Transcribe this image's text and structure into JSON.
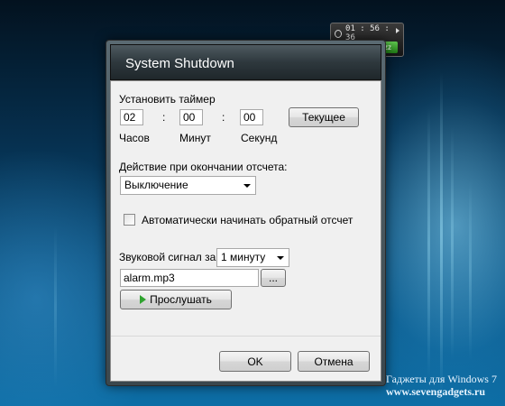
{
  "gadget": {
    "time": "01 : 56 : 36",
    "icons": [
      "clock-icon",
      "power-icon",
      "restart-icon",
      "sleep-icon"
    ]
  },
  "dialog": {
    "title": "System Shutdown",
    "timer": {
      "label": "Установить таймер",
      "hours": "02",
      "minutes": "00",
      "seconds": "00",
      "separator": ":",
      "hours_label": "Часов",
      "minutes_label": "Минут",
      "seconds_label": "Секунд",
      "current_button": "Текущее"
    },
    "action": {
      "label": "Действие при окончании отсчета:",
      "selected": "Выключение"
    },
    "autostart": {
      "label": "Автоматически начинать обратный отсчет",
      "checked": false
    },
    "sound": {
      "label": "Звуковой сигнал за",
      "interval_selected": "1 минуту",
      "file": "alarm.mp3",
      "browse_button": "...",
      "play_button": "Прослушать"
    },
    "ok_button": "OK",
    "cancel_button": "Отмена"
  },
  "watermark": {
    "line1": "Гаджеты для Windows 7",
    "line2": "www.sevengadgets.ru"
  },
  "colors": {
    "background": "#0a4f7c",
    "play_icon": "#2fa32f",
    "gadget_red": "#c0392b",
    "gadget_amber": "#d08a1c",
    "gadget_green": "#3aa02f"
  }
}
